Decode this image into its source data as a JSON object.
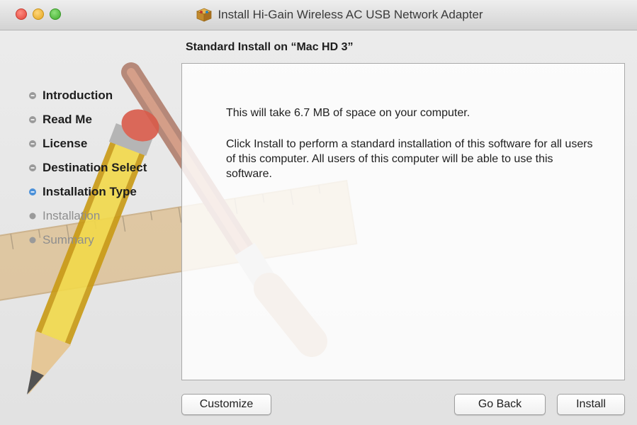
{
  "window": {
    "title": "Install Hi-Gain Wireless AC USB Network Adapter",
    "title_icon": "package-icon"
  },
  "sidebar": {
    "steps": [
      {
        "label": "Introduction",
        "state": "done"
      },
      {
        "label": "Read Me",
        "state": "done"
      },
      {
        "label": "License",
        "state": "done"
      },
      {
        "label": "Destination Select",
        "state": "done"
      },
      {
        "label": "Installation Type",
        "state": "current"
      },
      {
        "label": "Installation",
        "state": "pending"
      },
      {
        "label": "Summary",
        "state": "pending"
      }
    ]
  },
  "main": {
    "title": "Standard Install on “Mac HD 3”",
    "message_space": "This will take 6.7 MB of space on your computer.",
    "message_detail": "Click Install to perform a standard installation of this software for all users of this computer. All users of this computer will be able to use this software."
  },
  "buttons": {
    "customize": "Customize",
    "go_back": "Go Back",
    "install": "Install"
  },
  "colors": {
    "current_step_bullet": "#4a90d9",
    "step_bullet": "#8a8a8a"
  }
}
